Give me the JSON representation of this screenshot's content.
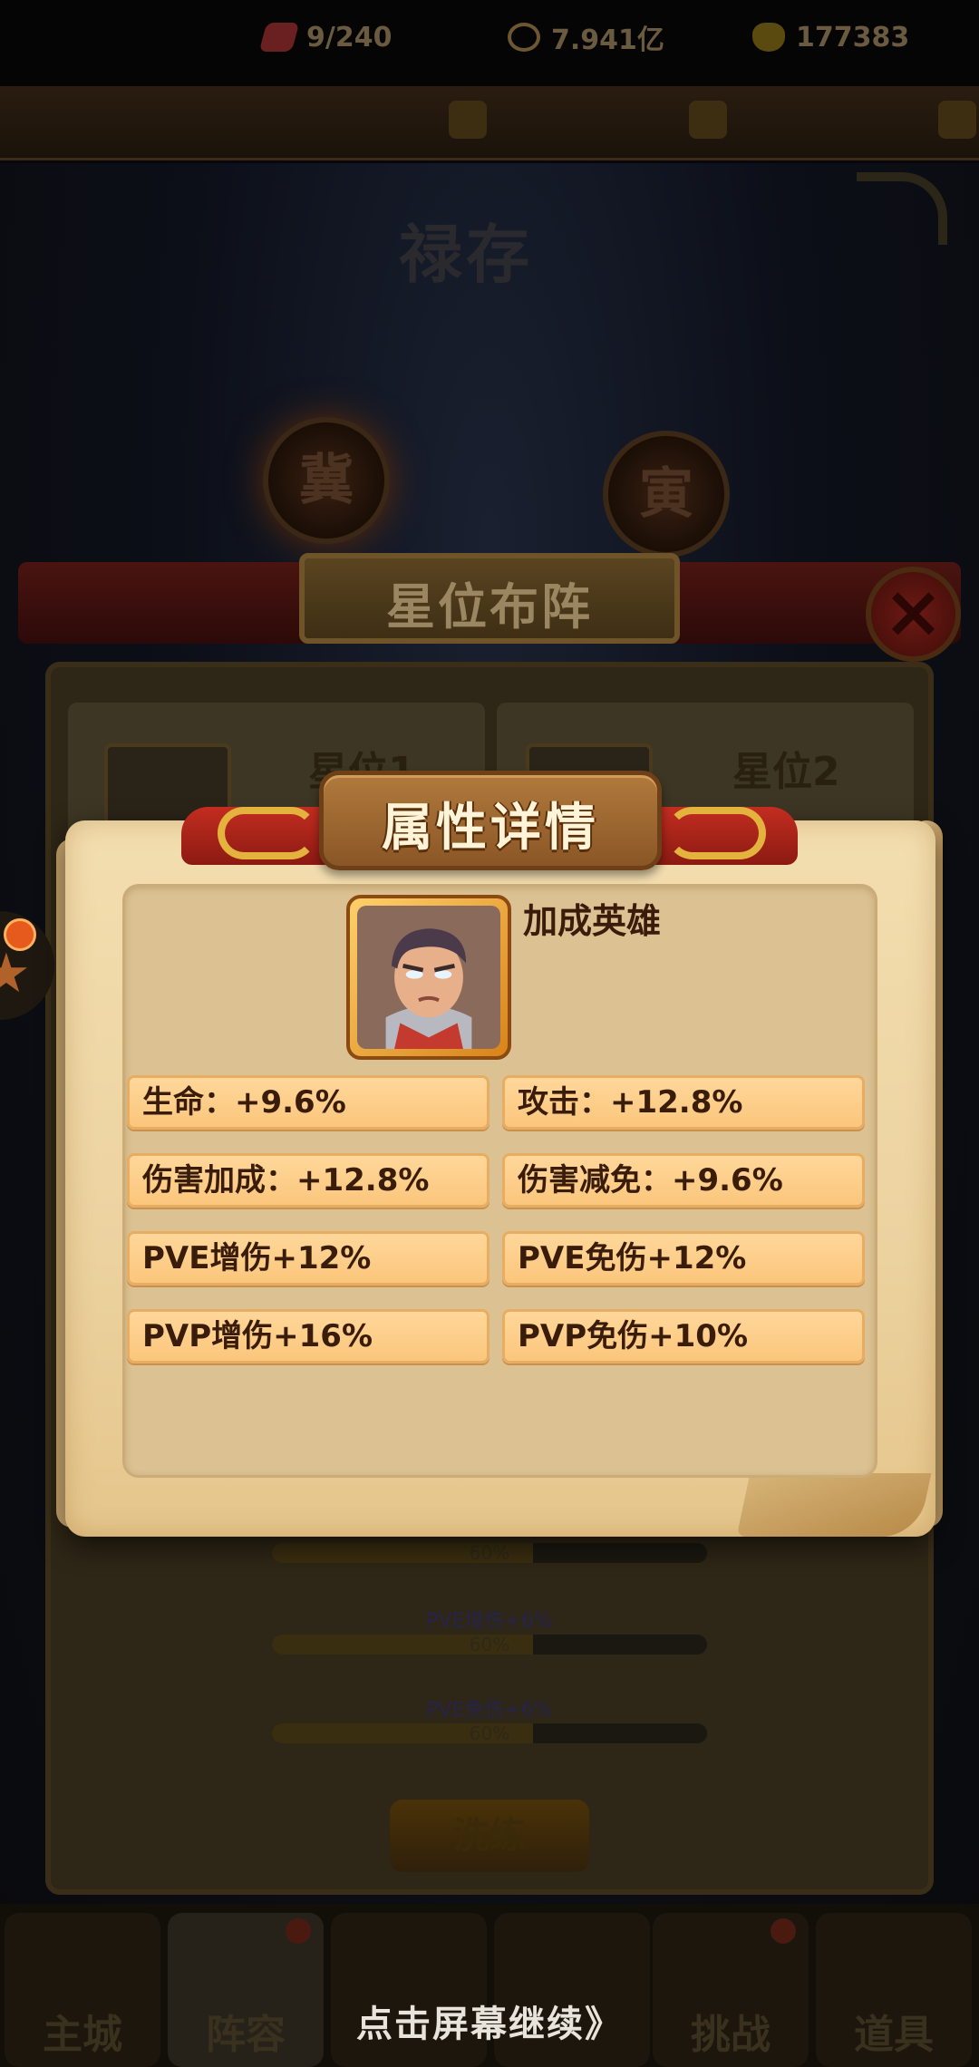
{
  "resources": {
    "energy": "9/240",
    "gold": "7.941亿",
    "diamond": "177383"
  },
  "background": {
    "page_title": "禄存",
    "zodiac_left": "冀",
    "zodiac_right": "寅",
    "panel_title": "星位布阵",
    "slot1_name": "星位1",
    "slot2_name": "星位2",
    "stats": [
      {
        "label": "",
        "percent": "60%",
        "fill": 0.6
      },
      {
        "label": "PVE增伤+6%",
        "percent": "60%",
        "fill": 0.6
      },
      {
        "label": "PVE免伤+6%",
        "percent": "60%",
        "fill": 0.6
      }
    ],
    "wash_button": "洗练"
  },
  "nav": {
    "items": [
      {
        "label": "主城",
        "active": false
      },
      {
        "label": "阵容",
        "active": true
      },
      {
        "label": "",
        "active": false
      },
      {
        "label": "",
        "active": false
      },
      {
        "label": "挑战",
        "active": false
      },
      {
        "label": "道具",
        "active": false
      }
    ]
  },
  "modal": {
    "title": "属性详情",
    "hero_label": "加成英雄",
    "stats": [
      "生命：+9.6%",
      "攻击：+12.8%",
      "伤害加成：+12.8%",
      "伤害减免：+9.6%",
      "PVE增伤+12%",
      "PVE免伤+12%",
      "PVP增伤+16%",
      "PVP免伤+10%"
    ]
  },
  "continue_text": "点击屏幕继续》",
  "colors": {
    "paper": "#f3deb0",
    "stat_fill": "#ffd79a",
    "text_dark": "#3a1c0a",
    "ribbon_red": "#c32d20",
    "gold_swirl": "#e3b33e"
  }
}
